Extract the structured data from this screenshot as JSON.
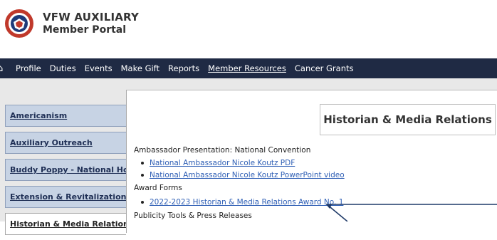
{
  "brand": {
    "line1": "VFW AUXILIARY",
    "line2": "Member Portal"
  },
  "nav": {
    "home_icon": "home-icon",
    "items": [
      {
        "label": "Profile"
      },
      {
        "label": "Duties"
      },
      {
        "label": "Events"
      },
      {
        "label": "Make Gift"
      },
      {
        "label": "Reports"
      },
      {
        "label": "Member Resources",
        "active": true
      },
      {
        "label": "Cancer Grants"
      }
    ]
  },
  "sidebar": {
    "items": [
      {
        "label": "Americanism"
      },
      {
        "label": "Auxiliary Outreach"
      },
      {
        "label": "Buddy Poppy - National Home"
      },
      {
        "label": "Extension & Revitalization"
      },
      {
        "label": "Historian & Media Relations",
        "active": true
      }
    ]
  },
  "main": {
    "title": "Historian & Media Relations",
    "sections": [
      {
        "heading": "Ambassador Presentation: National Convention",
        "links": [
          "National Ambassador Nicole Koutz PDF",
          "National Ambassador Nicole Koutz PowerPoint video"
        ]
      },
      {
        "heading": "Award Forms",
        "links": [
          "2022-2023 Historian & Media Relations Award No. 1"
        ]
      },
      {
        "heading": "Publicity Tools & Press Releases",
        "links": []
      }
    ]
  },
  "colors": {
    "nav_bg": "#1f2a44",
    "sidebar_tab_bg": "#c7d3e4",
    "link": "#2f5fb5",
    "annotation_arrow": "#1f3a68"
  }
}
